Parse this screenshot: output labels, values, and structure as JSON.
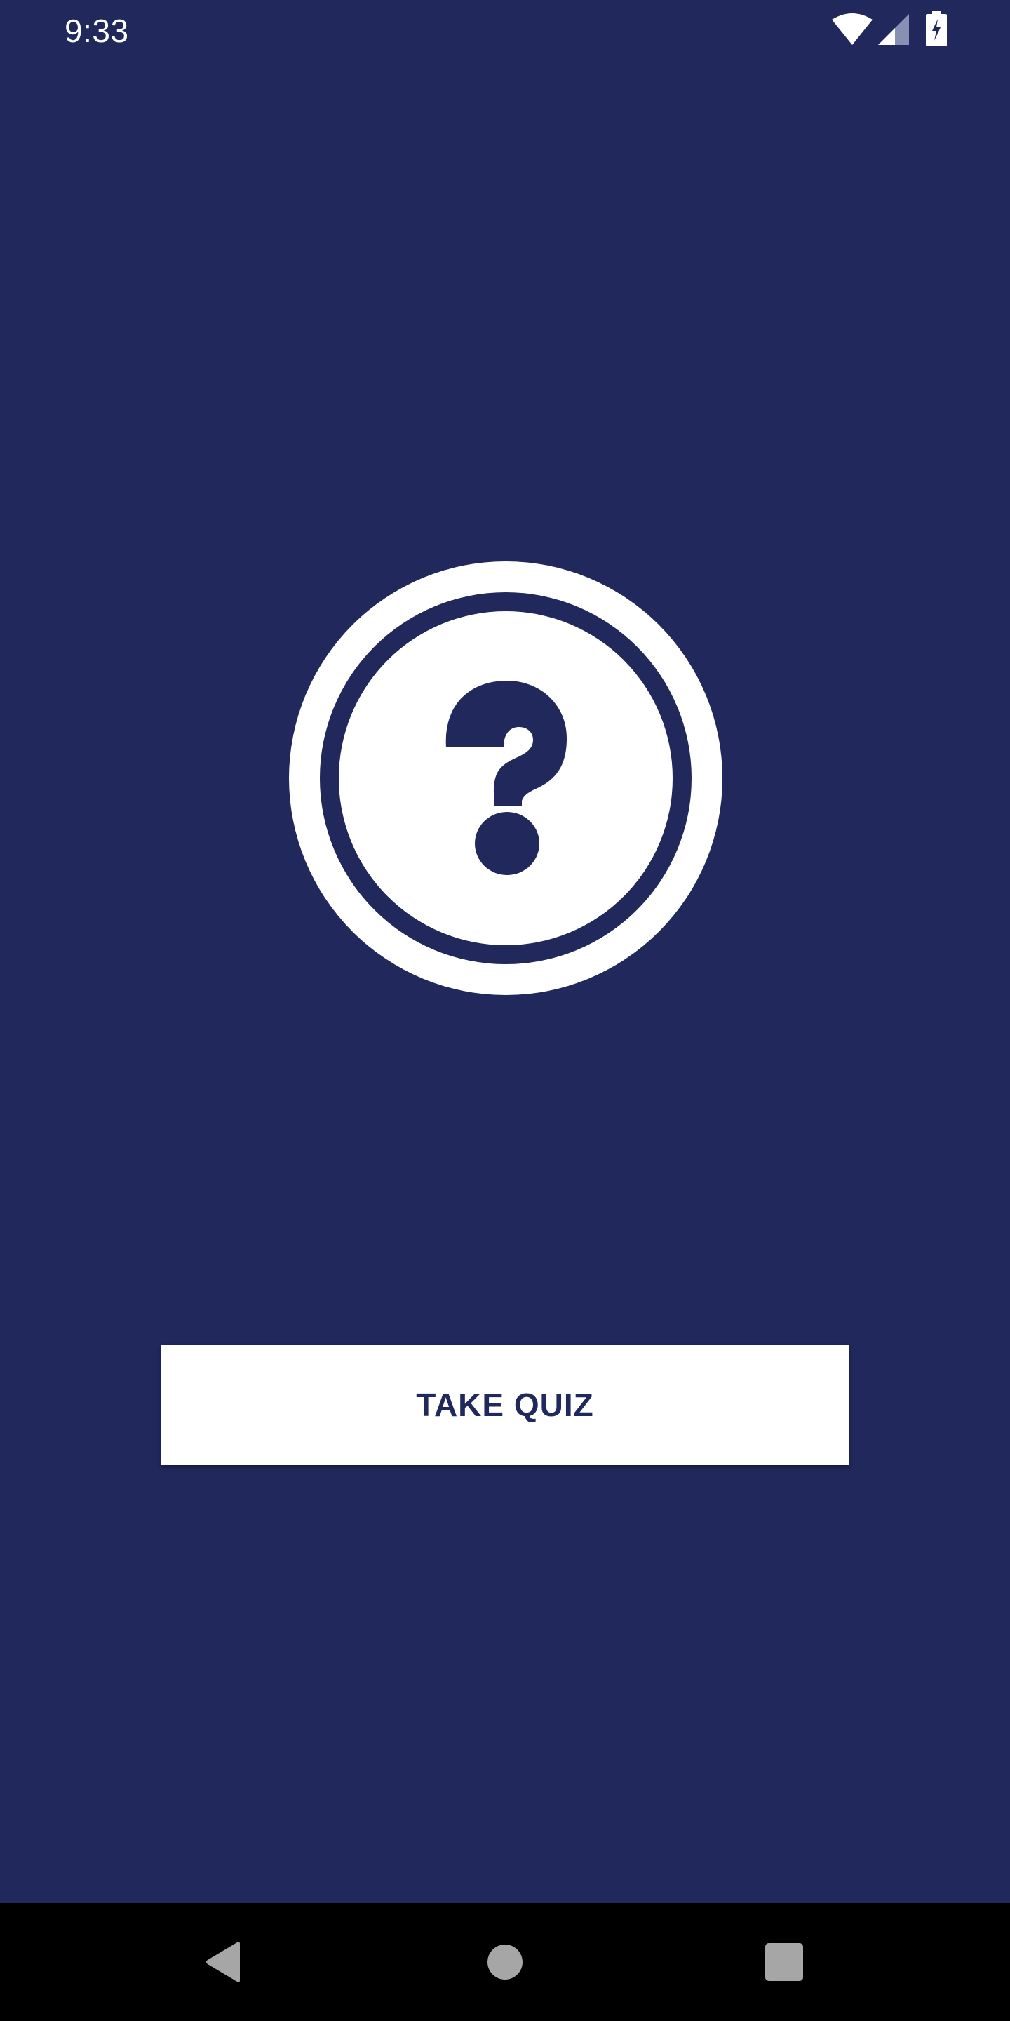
{
  "status_bar": {
    "time": "9:33",
    "icons": [
      "wifi-icon",
      "signal-icon",
      "battery-charging-icon"
    ]
  },
  "main": {
    "logo_icon": "question-mark-circle-icon",
    "take_quiz_label": "TAKE QUIZ"
  },
  "nav_bar": {
    "buttons": [
      "back-icon",
      "home-icon",
      "recents-icon"
    ]
  },
  "colors": {
    "background": "#20285c",
    "button_background": "#ffffff",
    "button_text": "#20285c",
    "nav_bar": "#000000",
    "nav_icons": "#a6a6a6"
  }
}
